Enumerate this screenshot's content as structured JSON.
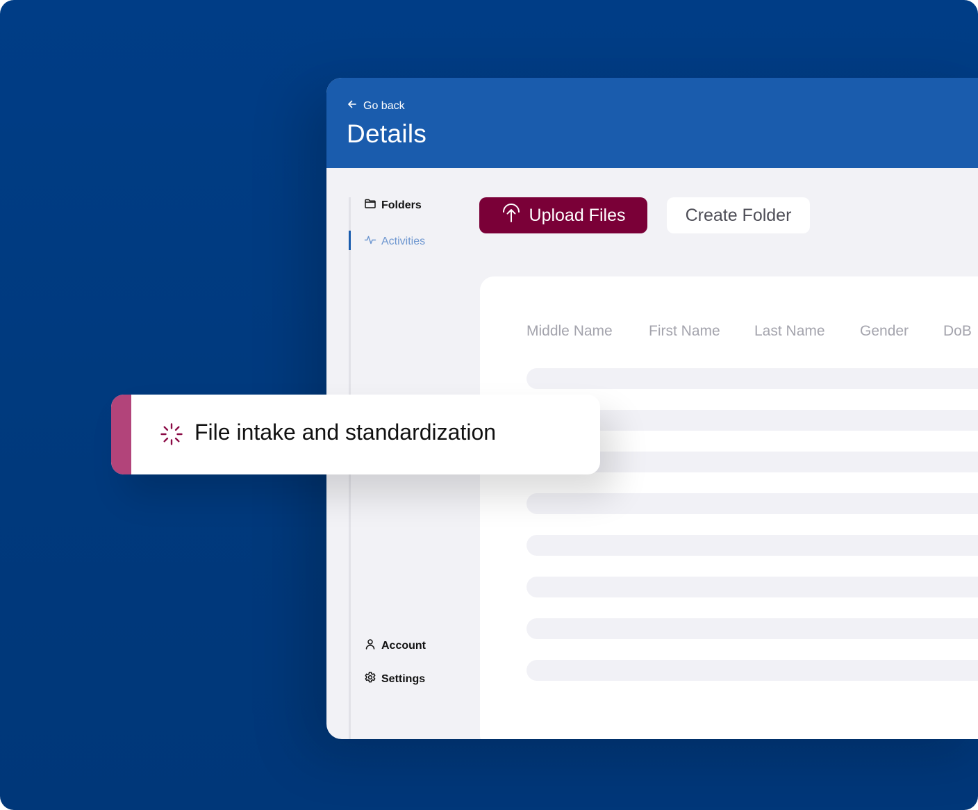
{
  "header": {
    "go_back_label": "Go back",
    "title": "Details"
  },
  "sidebar": {
    "top_items": [
      {
        "label": "Folders",
        "icon": "folder-icon",
        "active": false
      },
      {
        "label": "Activities",
        "icon": "activity-icon",
        "active": true
      }
    ],
    "bottom_items": [
      {
        "label": "Account",
        "icon": "user-icon"
      },
      {
        "label": "Settings",
        "icon": "gear-icon"
      }
    ]
  },
  "toolbar": {
    "upload_label": "Upload Files",
    "create_folder_label": "Create Folder"
  },
  "table": {
    "columns": [
      "Middle Name",
      "First Name",
      "Last Name",
      "Gender",
      "DoB"
    ],
    "row_state": "loading-skeleton"
  },
  "toast": {
    "message": "File intake and standardization",
    "icon": "spinner-icon"
  },
  "colors": {
    "background": "#003d86",
    "header": "#1a5cad",
    "primary_button": "#7a0037",
    "toast_accent": "#b2447a",
    "active_nav": "#6e97d0"
  }
}
